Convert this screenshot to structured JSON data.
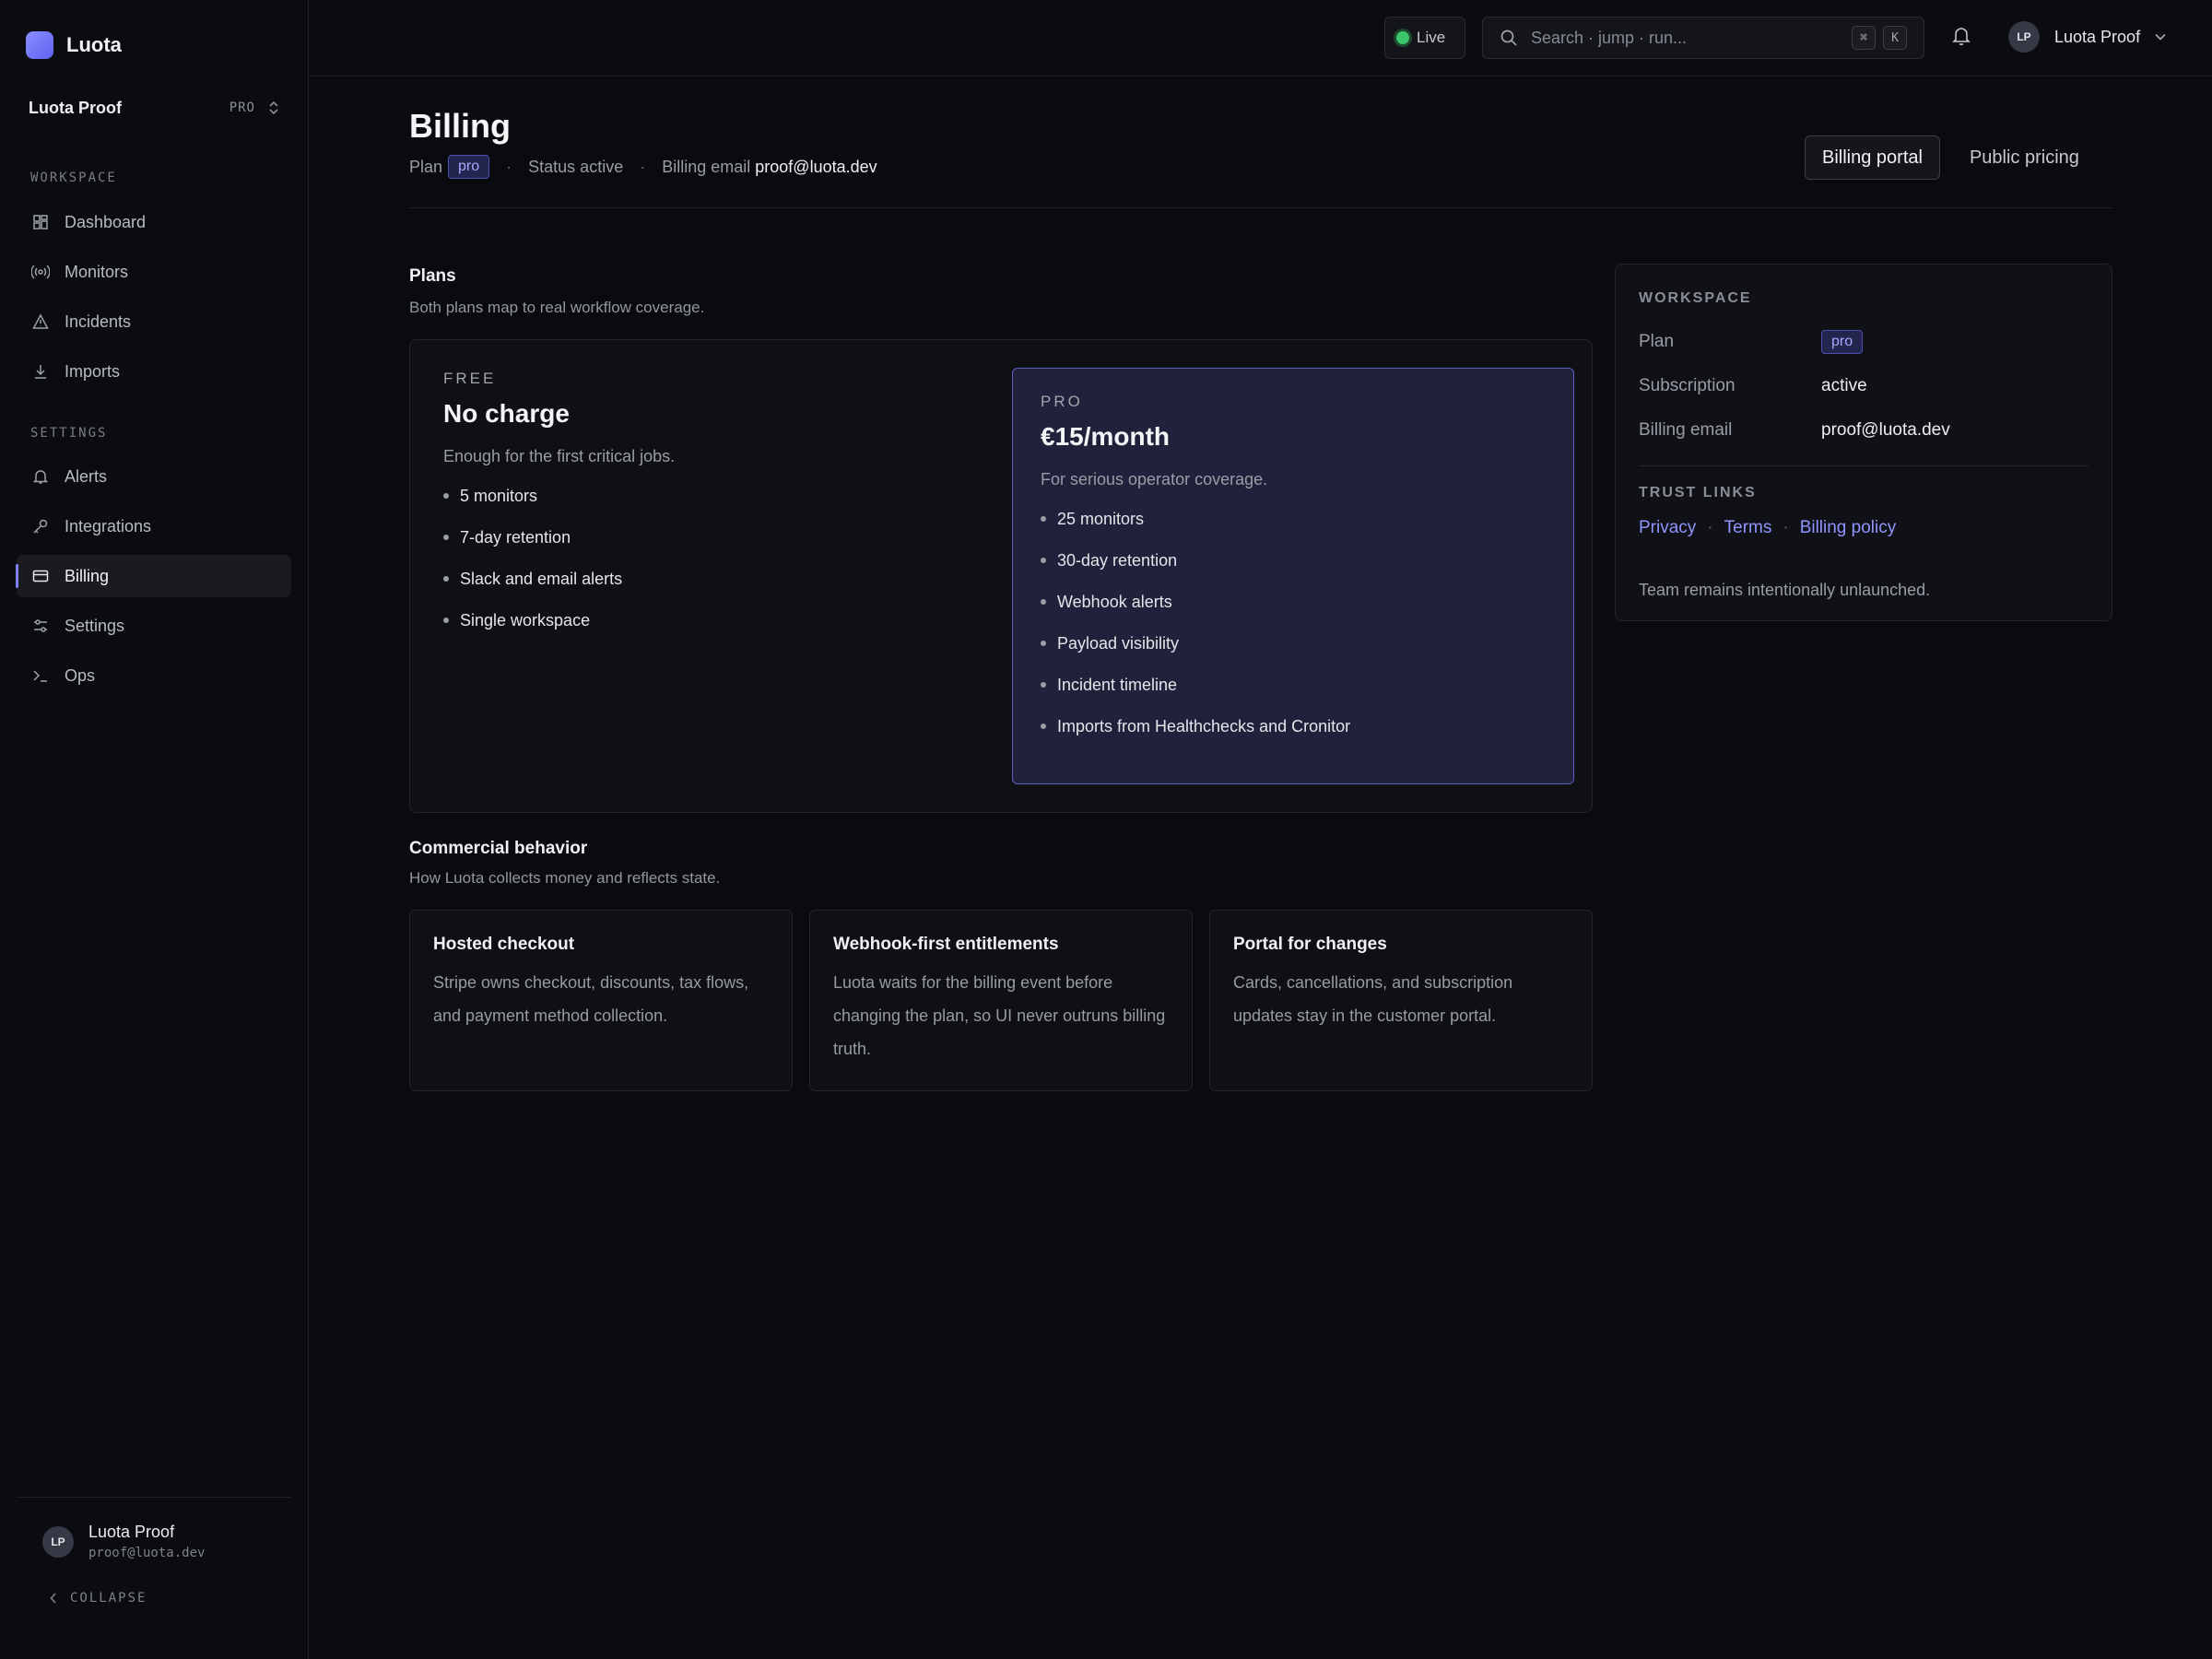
{
  "brand": {
    "name": "Luota",
    "accent": "#7c80ff"
  },
  "workspace_switcher": {
    "name": "Luota Proof",
    "tier": "PRO"
  },
  "sidebar": {
    "workspace_label": "WORKSPACE",
    "workspace_items": [
      {
        "label": "Dashboard",
        "icon": "grid-icon"
      },
      {
        "label": "Monitors",
        "icon": "broadcast-icon"
      },
      {
        "label": "Incidents",
        "icon": "warning-icon"
      },
      {
        "label": "Imports",
        "icon": "download-icon"
      }
    ],
    "settings_label": "SETTINGS",
    "settings_items": [
      {
        "label": "Alerts",
        "icon": "bell-icon"
      },
      {
        "label": "Integrations",
        "icon": "key-icon"
      },
      {
        "label": "Billing",
        "icon": "card-icon",
        "active": true
      },
      {
        "label": "Settings",
        "icon": "sliders-icon"
      },
      {
        "label": "Ops",
        "icon": "terminal-icon"
      }
    ],
    "user": {
      "initials": "LP",
      "name": "Luota Proof",
      "email": "proof@luota.dev"
    },
    "collapse_label": "COLLAPSE"
  },
  "topbar": {
    "live_label": "Live",
    "live_color": "#3cc56b",
    "search_placeholder": "Search · jump · run...",
    "kbd_mod": "⌘",
    "kbd_key": "K",
    "user_initials": "LP",
    "user_name": "Luota Proof"
  },
  "header": {
    "title": "Billing",
    "plan_label": "Plan",
    "plan_badge": "pro",
    "status_text": "Status active",
    "email_label": "Billing email",
    "email_value": "proof@luota.dev",
    "portal_button": "Billing portal",
    "pricing_button": "Public pricing"
  },
  "plans_section": {
    "title": "Plans",
    "subtitle": "Both plans map to real workflow coverage.",
    "free": {
      "tier": "FREE",
      "price": "No charge",
      "desc": "Enough for the first critical jobs.",
      "features": [
        "5 monitors",
        "7-day retention",
        "Slack and email alerts",
        "Single workspace"
      ]
    },
    "pro": {
      "tier": "PRO",
      "price": "€15/month",
      "desc": "For serious operator coverage.",
      "features": [
        "25 monitors",
        "30-day retention",
        "Webhook alerts",
        "Payload visibility",
        "Incident timeline",
        "Imports from Healthchecks and Cronitor"
      ]
    }
  },
  "commercial": {
    "title": "Commercial behavior",
    "subtitle": "How Luota collects money and reflects state.",
    "cards": [
      {
        "title": "Hosted checkout",
        "body": "Stripe owns checkout, discounts, tax flows, and payment method collection."
      },
      {
        "title": "Webhook-first entitlements",
        "body": "Luota waits for the billing event before changing the plan, so UI never outruns billing truth."
      },
      {
        "title": "Portal for changes",
        "body": "Cards, cancellations, and subscription updates stay in the customer portal."
      }
    ]
  },
  "workspace_panel": {
    "label": "WORKSPACE",
    "rows": [
      {
        "key": "Plan",
        "value": "pro"
      },
      {
        "key": "Subscription",
        "value": "active"
      },
      {
        "key": "Billing email",
        "value": "proof@luota.dev"
      }
    ],
    "trust_label": "TRUST LINKS",
    "links": [
      "Privacy",
      "Terms",
      "Billing policy"
    ],
    "note": "Team remains intentionally unlaunched."
  }
}
